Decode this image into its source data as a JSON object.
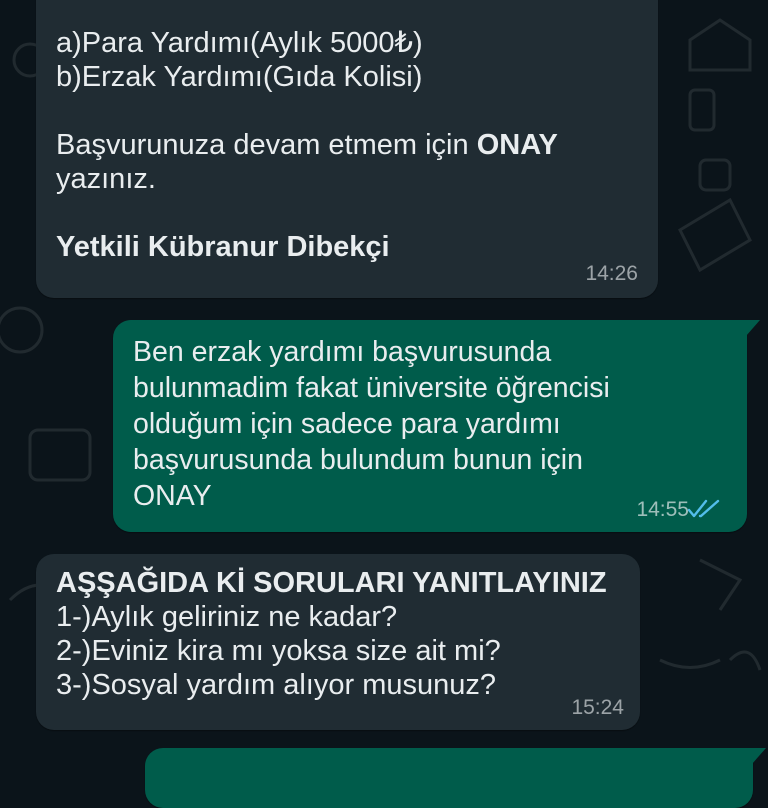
{
  "chat": {
    "messages": [
      {
        "direction": "incoming",
        "lines": [
          "a)Para Yardımı(Aylık 5000₺)",
          "b)Erzak Yardımı(Gıda Kolisi)"
        ],
        "prompt_text": "Başvurunuza devam etmem için ",
        "prompt_bold": "ONAY",
        "prompt_line2": "yazınız.",
        "signature": "Yetkili Kübranur Dibekçi",
        "time": "14:26"
      },
      {
        "direction": "outgoing",
        "lines": [
          "Ben erzak yardımı başvurusunda",
          "bulunmadim fakat üniversite öğrencisi",
          "olduğum için sadece para yardımı",
          "başvurusunda bulundum bunun için",
          "ONAY"
        ],
        "time": "14:55",
        "status": "read",
        "status_icon": "double-check-icon",
        "status_color": "#53bdeb"
      },
      {
        "direction": "incoming",
        "heading": "AŞŞAĞIDA Kİ SORULARI YANITLAYINIZ",
        "lines": [
          "1-)Aylık geliriniz ne kadar?",
          "2-)Eviniz kira mı yoksa size ait mi?",
          "3-)Sosyal yardım alıyor musunuz?"
        ],
        "time": "15:24"
      },
      {
        "direction": "outgoing",
        "partial": true
      }
    ]
  },
  "colors": {
    "background": "#0b141a",
    "incoming_bubble": "#202c33",
    "outgoing_bubble": "#005c4b",
    "text": "#e9edef",
    "read_ticks": "#53bdeb"
  }
}
